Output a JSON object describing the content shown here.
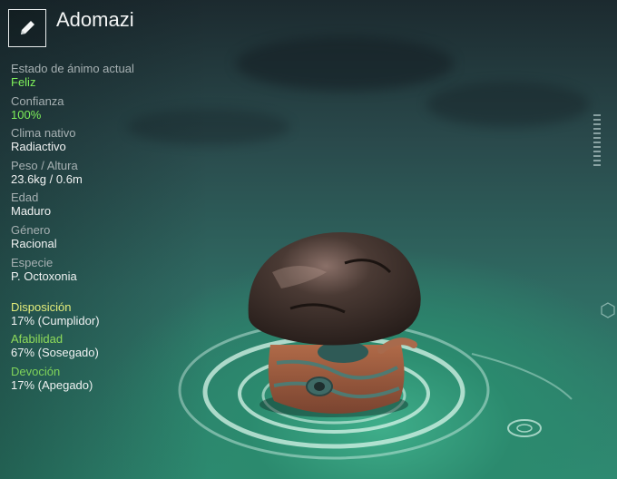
{
  "creature": {
    "name": "Adomazi"
  },
  "stats": [
    {
      "label": "Estado de ánimo actual",
      "value": "Feliz",
      "value_color": "green"
    },
    {
      "label": "Confianza",
      "value": "100%",
      "value_color": "green"
    },
    {
      "label": "Clima nativo",
      "value": "Radiactivo",
      "value_color": "white"
    },
    {
      "label": "Peso / Altura",
      "value": "23.6kg / 0.6m",
      "value_color": "white"
    },
    {
      "label": "Edad",
      "value": "Maduro",
      "value_color": "white"
    },
    {
      "label": "Género",
      "value": "Racional",
      "value_color": "white"
    },
    {
      "label": "Especie",
      "value": "P. Octoxonia",
      "value_color": "white"
    }
  ],
  "traits": [
    {
      "label": "Disposición",
      "value": "17% (Cumplidor)",
      "label_color": "#e3ec7a"
    },
    {
      "label": "Afabilidad",
      "value": "67% (Sosegado)",
      "label_color": "#8fdc5a"
    },
    {
      "label": "Devoción",
      "value": "17% (Apegado)",
      "label_color": "#7fd35a"
    }
  ],
  "icons": {
    "edit": "pencil-icon"
  }
}
